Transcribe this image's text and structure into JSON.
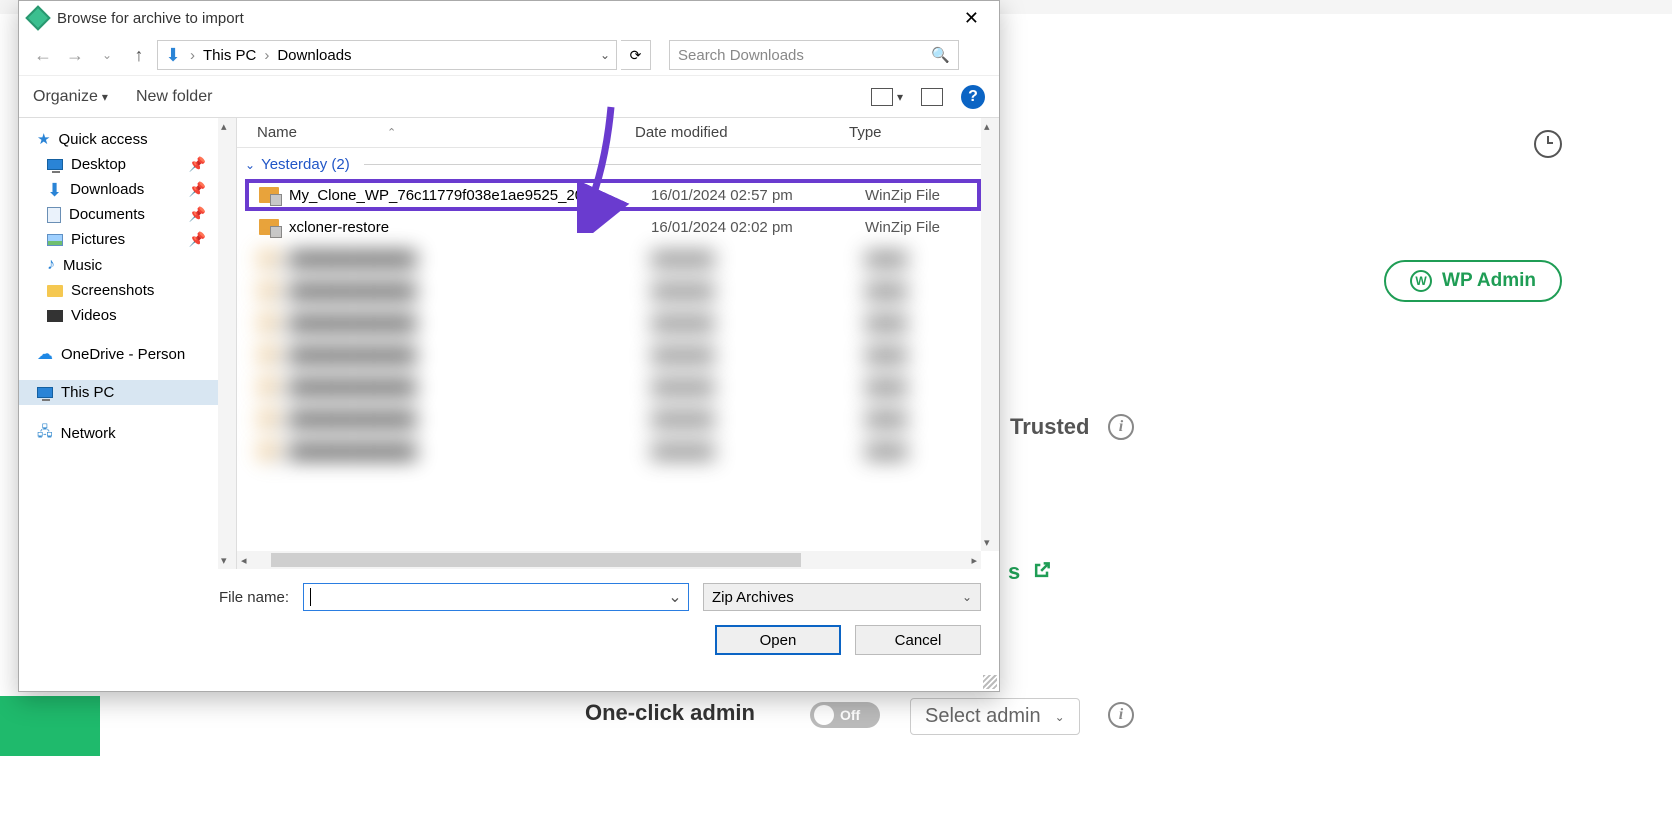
{
  "dialog": {
    "title": "Browse for archive to import",
    "breadcrumb": {
      "root": "This PC",
      "current": "Downloads"
    },
    "search_placeholder": "Search Downloads",
    "toolbar": {
      "organize": "Organize",
      "newfolder": "New folder"
    },
    "columns": {
      "name": "Name",
      "date": "Date modified",
      "type": "Type"
    },
    "group_label": "Yesterday (2)",
    "files": [
      {
        "name": "My_Clone_WP_76c11779f038e1ae9525_20...",
        "date": "16/01/2024 02:57 pm",
        "type": "WinZip File"
      },
      {
        "name": "xcloner-restore",
        "date": "16/01/2024 02:02 pm",
        "type": "WinZip File"
      }
    ],
    "filename_label": "File name:",
    "filter": "Zip Archives",
    "open": "Open",
    "cancel": "Cancel"
  },
  "sidebar": {
    "quick": "Quick access",
    "items": [
      "Desktop",
      "Downloads",
      "Documents",
      "Pictures",
      "Music",
      "Screenshots",
      "Videos"
    ],
    "onedrive": "OneDrive - Person",
    "thispc": "This PC",
    "network": "Network"
  },
  "bg": {
    "wpadmin": "WP Admin",
    "trusted": "Trusted",
    "oneclick": "One-click admin",
    "toggle": "Off",
    "select": "Select admin",
    "s": "s"
  }
}
